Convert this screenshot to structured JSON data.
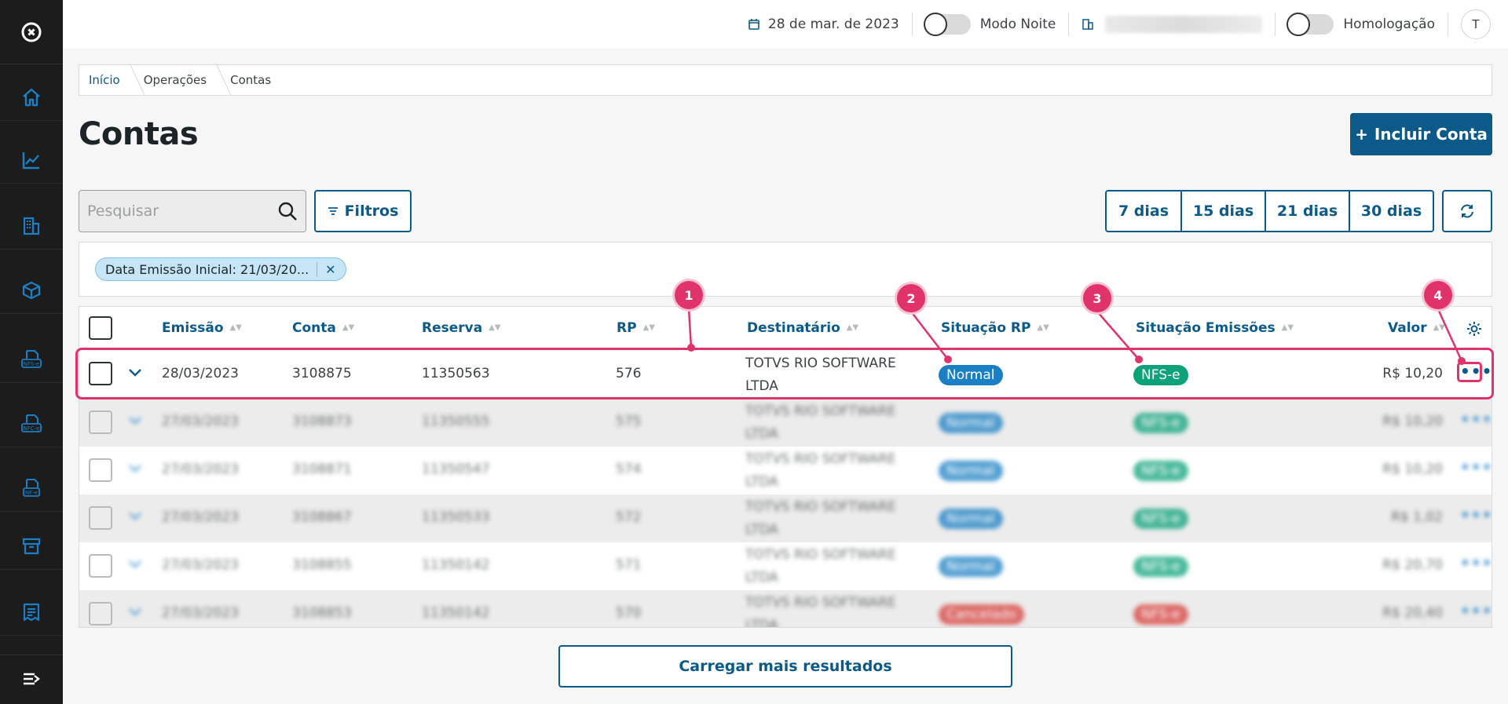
{
  "topbar": {
    "date": "28 de mar. de 2023",
    "night_mode_label": "Modo Noite",
    "homologation_label": "Homologação",
    "avatar_initial": "T"
  },
  "breadcrumb": [
    "Início",
    "Operações",
    "Contas"
  ],
  "page": {
    "title": "Contas",
    "add_button": "Incluir Conta"
  },
  "search": {
    "placeholder": "Pesquisar"
  },
  "filters_button": "Filtros",
  "periods": [
    "7 dias",
    "15 dias",
    "21 dias",
    "30 dias"
  ],
  "active_filter_chip": "Data Emissão Inicial: 21/03/20...",
  "table": {
    "columns": [
      "Emissão",
      "Conta",
      "Reserva",
      "RP",
      "Destinatário",
      "Situação RP",
      "Situação Emissões",
      "Valor"
    ],
    "rows": [
      {
        "emissao": "28/03/2023",
        "conta": "3108875",
        "reserva": "11350563",
        "rp": "576",
        "destinatario": [
          "TOTVS RIO SOFTWARE",
          "LTDA"
        ],
        "situacao_rp": "Normal",
        "situacao_emissoes": "NFS-e",
        "valor": "R$ 10,20"
      },
      {
        "emissao": "27/03/2023",
        "conta": "3108873",
        "reserva": "11350555",
        "rp": "575",
        "destinatario": [
          "TOTVS RIO SOFTWARE",
          "LTDA"
        ],
        "situacao_rp": "Normal",
        "situacao_emissoes": "NFS-e",
        "valor": "R$ 10,20"
      },
      {
        "emissao": "27/03/2023",
        "conta": "3108871",
        "reserva": "11350547",
        "rp": "574",
        "destinatario": [
          "TOTVS RIO SOFTWARE",
          "LTDA"
        ],
        "situacao_rp": "Normal",
        "situacao_emissoes": "NFS-e",
        "valor": "R$ 10,20"
      },
      {
        "emissao": "27/03/2023",
        "conta": "3108867",
        "reserva": "11350533",
        "rp": "572",
        "destinatario": [
          "TOTVS RIO SOFTWARE",
          "LTDA"
        ],
        "situacao_rp": "Normal",
        "situacao_emissoes": "NFS-e",
        "valor": "R$ 1,02"
      },
      {
        "emissao": "27/03/2023",
        "conta": "3108855",
        "reserva": "11350142",
        "rp": "571",
        "destinatario": [
          "TOTVS RIO SOFTWARE",
          "LTDA"
        ],
        "situacao_rp": "Normal",
        "situacao_emissoes": "NFS-e",
        "valor": "R$ 20,70"
      },
      {
        "emissao": "27/03/2023",
        "conta": "3108853",
        "reserva": "11350142",
        "rp": "570",
        "destinatario": [
          "TOTVS RIO SOFTWARE",
          "LTDA"
        ],
        "situacao_rp": "Cancelado",
        "situacao_emissoes": "NFS-e",
        "valor": "R$ 20,40"
      }
    ]
  },
  "load_more": "Carregar mais resultados",
  "callouts": [
    "1",
    "2",
    "3",
    "4"
  ],
  "colors": {
    "primary": "#0c5a8a",
    "highlight": "#e0336a",
    "badge_normal": "#1a7fc4",
    "badge_nfse": "#0ea27a",
    "badge_cancel": "#d8403c",
    "sidebar": "#1c1c1c"
  },
  "sidebar_icons": [
    "logo-icon",
    "home-icon",
    "chart-icon",
    "building-icon",
    "box-icon",
    "nfs-e-icon",
    "nfc-e-icon",
    "nf-e-icon",
    "archive-icon",
    "receipt-icon",
    "menu-collapse-icon"
  ]
}
